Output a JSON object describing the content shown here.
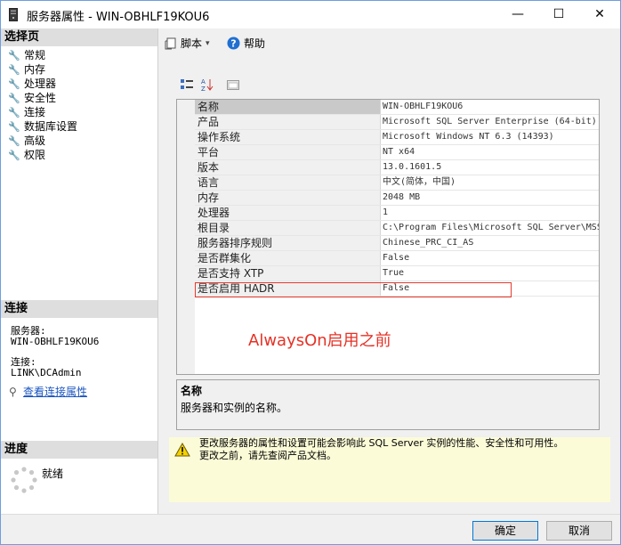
{
  "window": {
    "title": "服务器属性 - WIN-OBHLF19KOU6",
    "minimize": "—",
    "maximize": "☐",
    "close": "✕"
  },
  "left": {
    "select_page_label": "选择页",
    "pages": [
      "常规",
      "内存",
      "处理器",
      "安全性",
      "连接",
      "数据库设置",
      "高级",
      "权限"
    ],
    "connection_label": "连接",
    "server_label": "服务器:",
    "server_value": "WIN-OBHLF19KOU6",
    "conn_label": "连接:",
    "conn_value": "LINK\\DCAdmin",
    "view_conn_link": "查看连接属性",
    "progress_label": "进度",
    "status": "就绪"
  },
  "toolbar": {
    "script_label": "脚本",
    "help_label": "帮助"
  },
  "properties": [
    {
      "name": "名称",
      "value": "WIN-OBHLF19KOU6"
    },
    {
      "name": "产品",
      "value": "Microsoft SQL Server Enterprise (64-bit)"
    },
    {
      "name": "操作系统",
      "value": "Microsoft Windows NT 6.3 (14393)"
    },
    {
      "name": "平台",
      "value": "NT x64"
    },
    {
      "name": "版本",
      "value": "13.0.1601.5"
    },
    {
      "name": "语言",
      "value": "中文(简体，中国)"
    },
    {
      "name": "内存",
      "value": "2048 MB"
    },
    {
      "name": "处理器",
      "value": "1"
    },
    {
      "name": "根目录",
      "value": "C:\\Program Files\\Microsoft SQL Server\\MSSQL"
    },
    {
      "name": "服务器排序规则",
      "value": "Chinese_PRC_CI_AS"
    },
    {
      "name": "是否群集化",
      "value": "False"
    },
    {
      "name": "是否支持 XTP",
      "value": "True"
    },
    {
      "name": "是否启用 HADR",
      "value": "False"
    }
  ],
  "annotation": "AlwaysOn启用之前",
  "description": {
    "title": "名称",
    "text": "服务器和实例的名称。"
  },
  "warning": {
    "line1": "更改服务器的属性和设置可能会影响此 SQL Server 实例的性能、安全性和可用性。",
    "line2": "更改之前，请先查阅产品文档。"
  },
  "buttons": {
    "ok": "确定",
    "cancel": "取消"
  },
  "colors": {
    "highlight_box": "#e53a2e",
    "annotation": "#e53226",
    "link": "#1b56c1",
    "warning_bg": "#fbfbd8"
  }
}
